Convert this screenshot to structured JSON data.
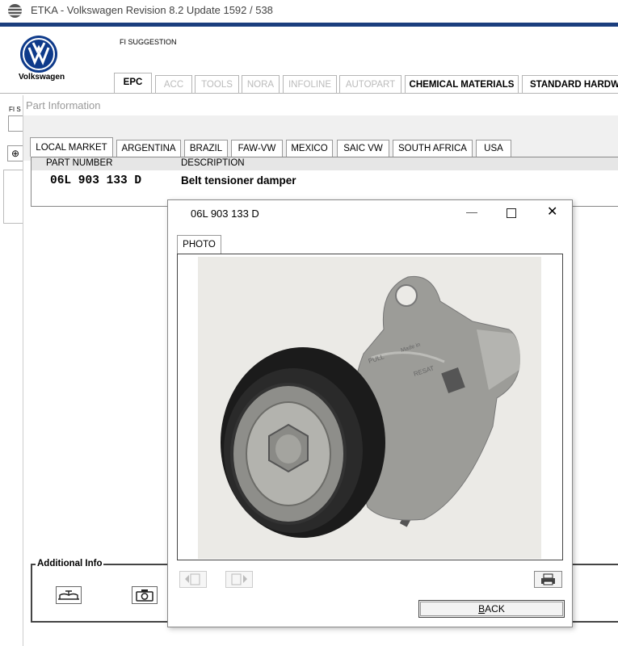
{
  "app": {
    "title": "ETKA - Volkswagen Revision 8.2 Update 1592 / 538"
  },
  "header": {
    "brand": "Volkswagen",
    "fi_suggestion": "FI SUGGESTION",
    "tabs": [
      "EPC",
      "ACC",
      "TOOLS",
      "NORA",
      "INFOLINE",
      "AUTOPART",
      "CHEMICAL MATERIALS",
      "STANDARD HARDWAR"
    ]
  },
  "left": {
    "fi_label": "FI S"
  },
  "part_info": {
    "title": "Part Information",
    "market_tabs": [
      "LOCAL MARKET",
      "ARGENTINA",
      "BRAZIL",
      "FAW-VW",
      "MEXICO",
      "SAIC VW",
      "SOUTH AFRICA",
      "USA"
    ],
    "columns": [
      "PART NUMBER",
      "DESCRIPTION"
    ],
    "rows": [
      {
        "part_number": "06L 903 133 D",
        "description": "Belt tensioner damper"
      }
    ],
    "additional_info_label": "Additional Info"
  },
  "dialog": {
    "title": "06L 903 133 D",
    "tab": "PHOTO",
    "back_label": "BACK",
    "back_accel": "B",
    "back_rest": "ACK",
    "photo_markings": [
      "PULL",
      "Made in",
      "RESAT"
    ]
  },
  "colors": {
    "accent_bar": "#1b3e7e",
    "vw_blue": "#0e3a8a"
  }
}
